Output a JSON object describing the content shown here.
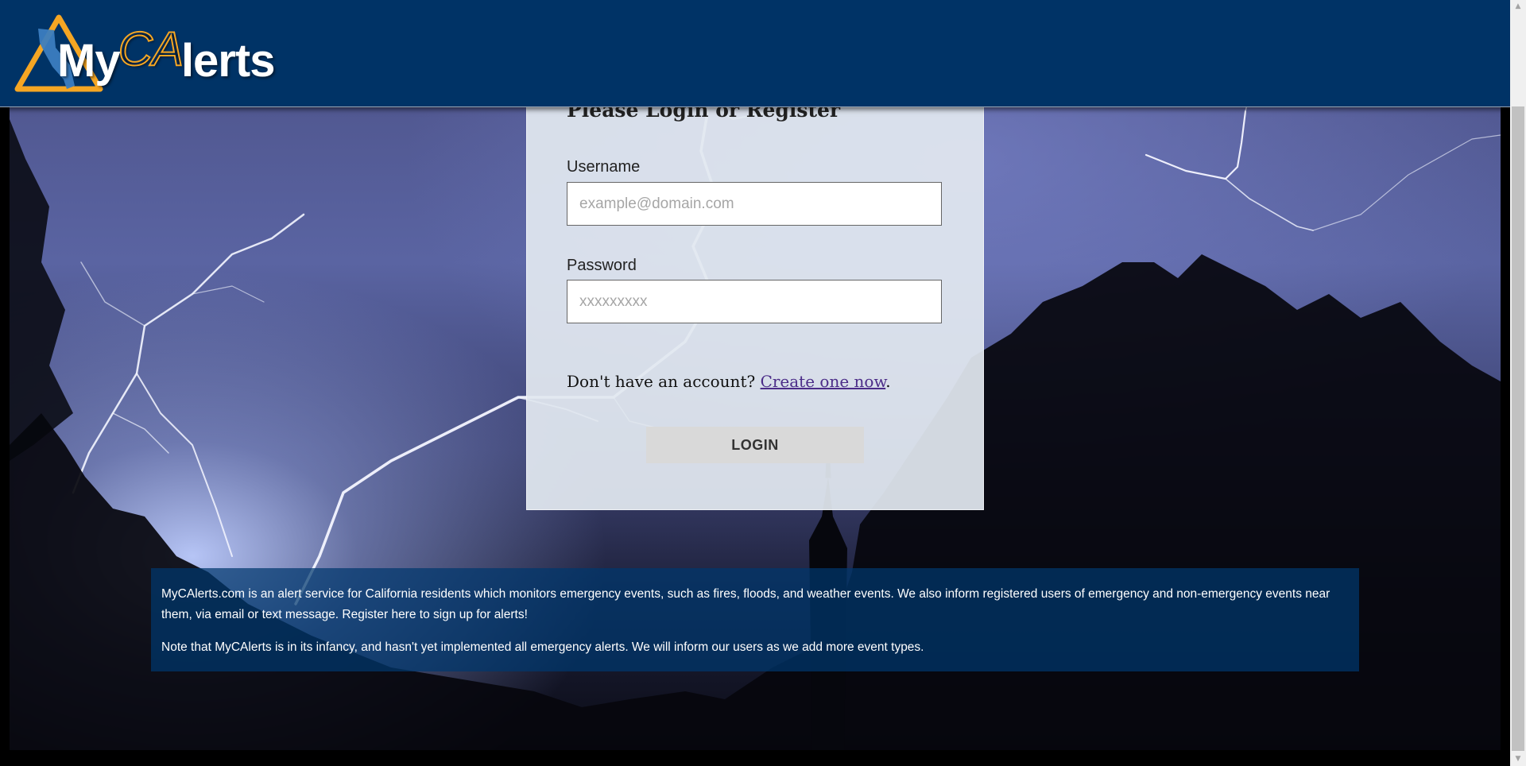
{
  "header": {
    "logo_text_my": "My",
    "logo_text_ca": "CA",
    "logo_text_alerts": "lerts",
    "bg_color": "#003366",
    "accent_color": "#f5a623"
  },
  "login": {
    "title": "Please Login or Register",
    "username_label": "Username",
    "username_placeholder": "example@domain.com",
    "username_value": "",
    "password_label": "Password",
    "password_placeholder": "xxxxxxxxx",
    "password_value": "",
    "register_prefix": "Don't have an account?",
    "register_link": "Create one now",
    "register_suffix": ".",
    "login_button": "LOGIN"
  },
  "info": {
    "paragraph1": "MyCAlerts.com is an alert service for California residents which monitors emergency events, such as fires, floods, and weather events. We also inform registered users of emergency and non-emergency events near them, via email or text message. Register here to sign up for alerts!",
    "paragraph2": "Note that MyCAlerts is in its infancy, and hasn't yet implemented all emergency alerts. We will inform our users as we add more event types."
  },
  "scrollbar": {
    "up_icon": "triangle-up-icon",
    "down_icon": "triangle-down-icon"
  }
}
